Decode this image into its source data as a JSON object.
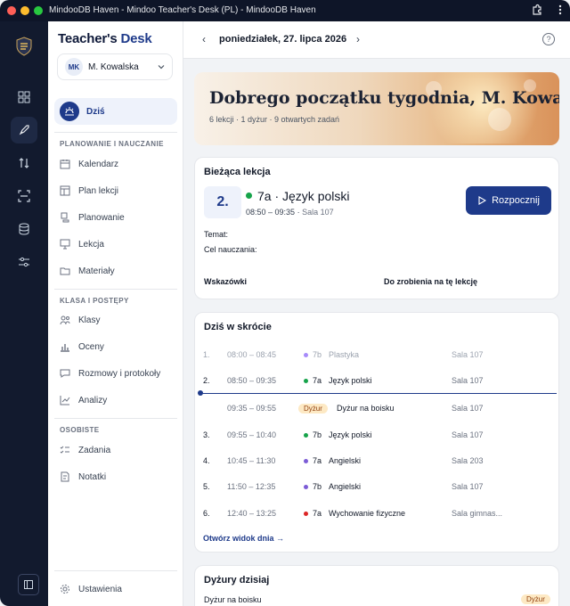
{
  "window": {
    "title": "MindooDB Haven - Mindoo Teacher's Desk (PL) - MindooDB Haven"
  },
  "colors": {
    "accent": "#1e3a8a",
    "rail": "#121a2e",
    "green": "#16a34a",
    "purple": "#7c5cd6",
    "red": "#dc2626",
    "badge": "#fde9c4"
  },
  "sidebar": {
    "brand_1": "Teacher's",
    "brand_2": "Desk",
    "user": {
      "initials": "MK",
      "name": "M. Kowalska"
    },
    "today_label": "Dziś",
    "sections": [
      {
        "title": "PLANOWANIE I NAUCZANIE",
        "items": [
          "Kalendarz",
          "Plan lekcji",
          "Planowanie",
          "Lekcja",
          "Materiały"
        ]
      },
      {
        "title": "KLASA I POSTĘPY",
        "items": [
          "Klasy",
          "Oceny",
          "Rozmowy i protokoły",
          "Analizy"
        ]
      },
      {
        "title": "OSOBISTE",
        "items": [
          "Zadania",
          "Notatki"
        ]
      }
    ],
    "settings_label": "Ustawienia"
  },
  "topbar": {
    "date": "poniedziałek, 27. lipca 2026",
    "prev": "‹",
    "next": "›",
    "help": "?"
  },
  "hero": {
    "title": "Dobrego początku tygodnia, M. Kowalska",
    "subtitle": "6 lekcji · 1 dyżur · 9 otwartych zadań"
  },
  "current_lesson": {
    "heading": "Bieżąca lekcja",
    "number": "2.",
    "title": "7a · Język polski",
    "time": "08:50 – 09:35",
    "room": "Sala 107",
    "start_button": "Rozpocznij",
    "topic_label": "Temat:",
    "goal_label": "Cel nauczania:",
    "hints_label": "Wskazówki",
    "todo_label": "Do zrobienia na tę lekcję"
  },
  "overview": {
    "heading": "Dziś w skrócie",
    "rows": [
      {
        "num": "1.",
        "time": "08:00 – 08:45",
        "cls": "7b",
        "dot": "#a78bfa",
        "subject": "Plastyka",
        "room": "Sala 107"
      },
      {
        "num": "2.",
        "time": "08:50 – 09:35",
        "cls": "7a",
        "dot": "#16a34a",
        "subject": "Język polski",
        "room": "Sala 107"
      },
      {
        "num": "",
        "time": "09:35 – 09:55",
        "cls": "Dyżur",
        "dot": "",
        "subject": "Dyżur na boisku",
        "room": "Sala 107"
      },
      {
        "num": "3.",
        "time": "09:55 – 10:40",
        "cls": "7b",
        "dot": "#16a34a",
        "subject": "Język polski",
        "room": "Sala 107"
      },
      {
        "num": "4.",
        "time": "10:45 – 11:30",
        "cls": "7a",
        "dot": "#7c5cd6",
        "subject": "Angielski",
        "room": "Sala 203"
      },
      {
        "num": "5.",
        "time": "11:50 – 12:35",
        "cls": "7b",
        "dot": "#7c5cd6",
        "subject": "Angielski",
        "room": "Sala 107"
      },
      {
        "num": "6.",
        "time": "12:40 – 13:25",
        "cls": "7a",
        "dot": "#dc2626",
        "subject": "Wychowanie fizyczne",
        "room": "Sala gimnas..."
      }
    ],
    "link": "Otwórz widok dnia →"
  },
  "duties": {
    "heading": "Dyżury dzisiaj",
    "item": "Dyżur na boisku",
    "badge": "Dyżur"
  }
}
